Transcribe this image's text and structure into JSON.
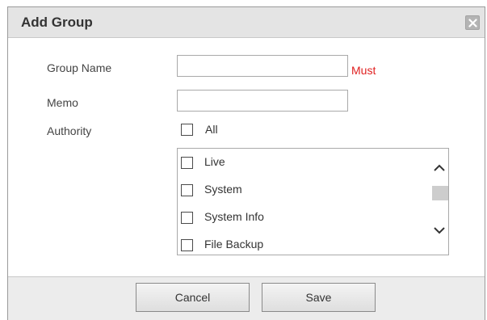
{
  "dialog": {
    "title": "Add Group",
    "close_icon": "close-x-icon"
  },
  "form": {
    "group_name": {
      "label": "Group Name",
      "value": "",
      "required_note": "Must"
    },
    "memo": {
      "label": "Memo",
      "value": ""
    },
    "authority": {
      "label": "Authority",
      "all_label": "All",
      "all_checked": false,
      "items": [
        {
          "label": "Live",
          "checked": false
        },
        {
          "label": "System",
          "checked": false
        },
        {
          "label": "System Info",
          "checked": false
        },
        {
          "label": "File Backup",
          "checked": false
        }
      ],
      "scroll_icons": [
        "chevron-up-icon",
        "chevron-down-icon"
      ]
    }
  },
  "footer": {
    "cancel_label": "Cancel",
    "save_label": "Save"
  },
  "colors": {
    "required": "#e02020",
    "title_bar": "#e4e4e4",
    "footer": "#ececec"
  }
}
